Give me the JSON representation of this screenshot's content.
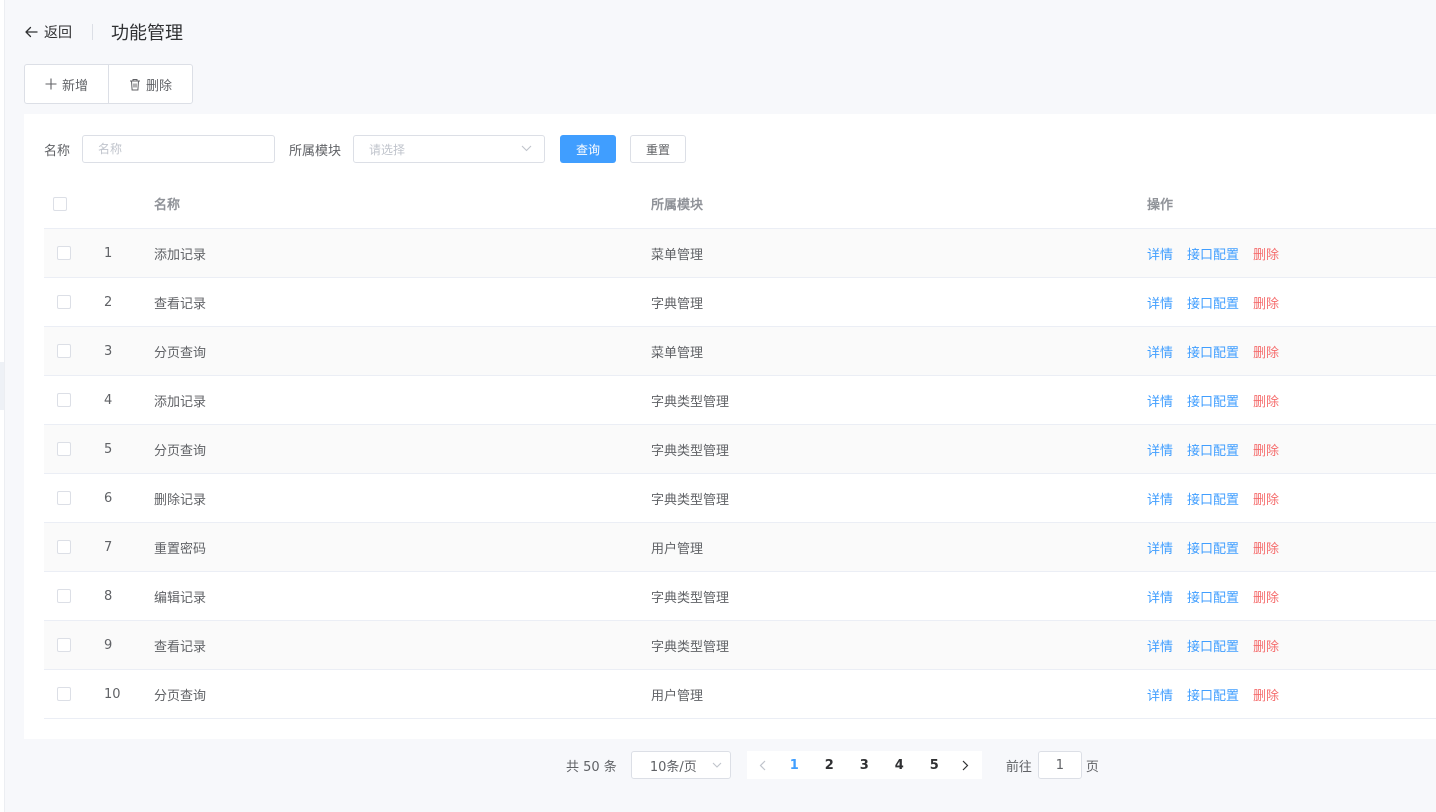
{
  "header": {
    "back_label": "返回",
    "title": "功能管理"
  },
  "toolbar": {
    "add_label": "新增",
    "delete_label": "删除"
  },
  "filter": {
    "name_label": "名称",
    "name_placeholder": "名称",
    "module_label": "所属模块",
    "module_placeholder": "请选择",
    "search_label": "查询",
    "reset_label": "重置"
  },
  "table": {
    "columns": {
      "name": "名称",
      "module": "所属模块",
      "ops": "操作"
    },
    "actions": {
      "detail": "详情",
      "config": "接口配置",
      "delete": "删除"
    },
    "rows": [
      {
        "index": "1",
        "name": "添加记录",
        "module": "菜单管理"
      },
      {
        "index": "2",
        "name": "查看记录",
        "module": "字典管理"
      },
      {
        "index": "3",
        "name": "分页查询",
        "module": "菜单管理"
      },
      {
        "index": "4",
        "name": "添加记录",
        "module": "字典类型管理"
      },
      {
        "index": "5",
        "name": "分页查询",
        "module": "字典类型管理"
      },
      {
        "index": "6",
        "name": "删除记录",
        "module": "字典类型管理"
      },
      {
        "index": "7",
        "name": "重置密码",
        "module": "用户管理"
      },
      {
        "index": "8",
        "name": "编辑记录",
        "module": "字典类型管理"
      },
      {
        "index": "9",
        "name": "查看记录",
        "module": "字典类型管理"
      },
      {
        "index": "10",
        "name": "分页查询",
        "module": "用户管理"
      }
    ]
  },
  "pagination": {
    "total_label": "共 50 条",
    "page_size": "10条/页",
    "pages": [
      "1",
      "2",
      "3",
      "4",
      "5"
    ],
    "current_page": "1",
    "goto_prefix": "前往",
    "goto_value": "1",
    "goto_suffix": "页"
  },
  "colors": {
    "primary": "#409eff",
    "danger": "#f56c6c",
    "background": "#f7f8fb"
  }
}
